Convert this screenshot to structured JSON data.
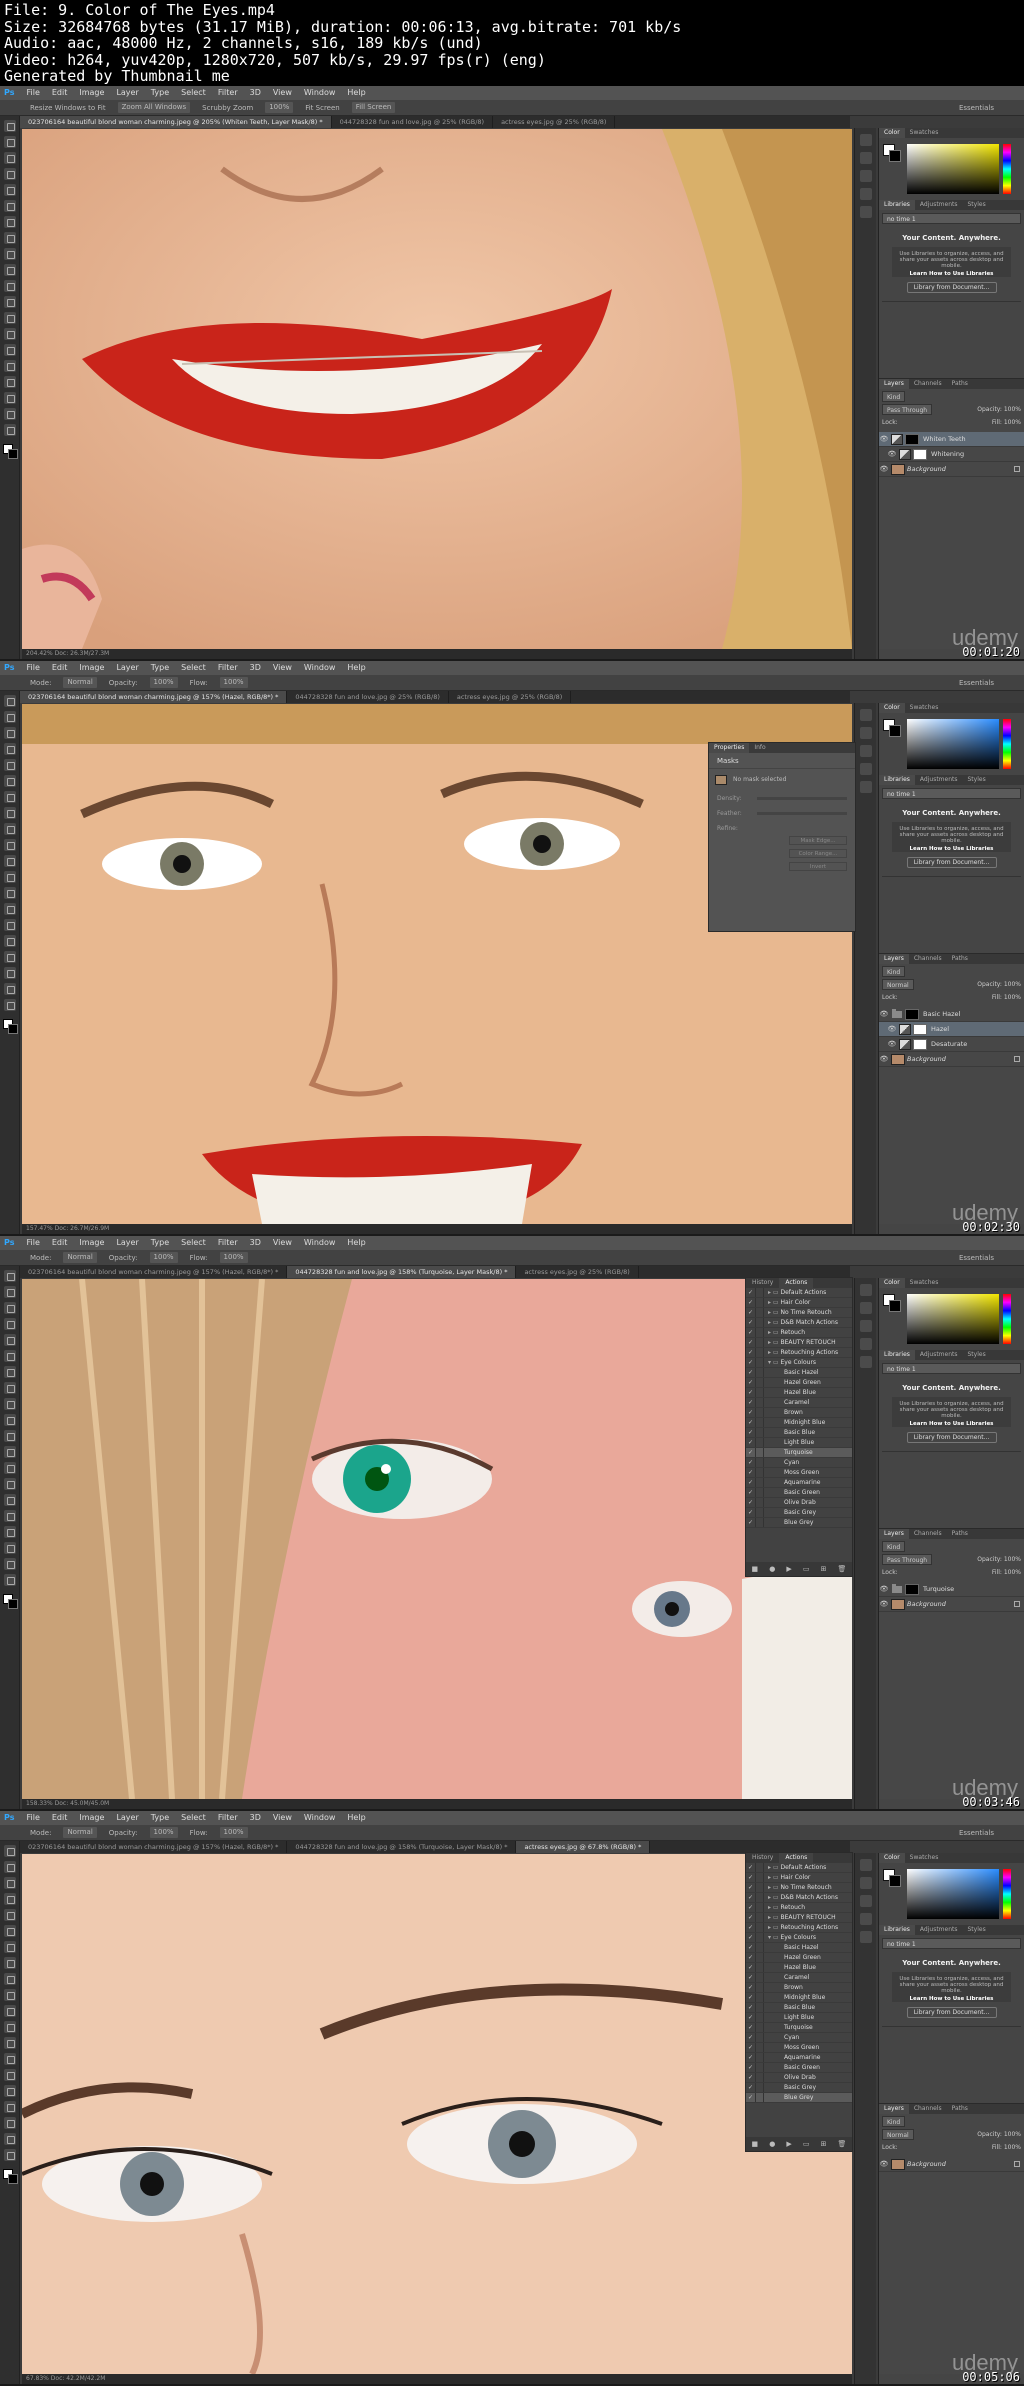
{
  "header": {
    "lines": [
      "File: 9. Color of The Eyes.mp4",
      "Size: 32684768 bytes (31.17 MiB), duration: 00:06:13, avg.bitrate: 701 kb/s",
      "Audio: aac, 48000 Hz, 2 channels, s16, 189 kb/s (und)",
      "Video: h264, yuv420p, 1280x720, 507 kb/s, 29.97 fps(r) (eng)",
      "Generated by Thumbnail me"
    ]
  },
  "menu": [
    "File",
    "Edit",
    "Image",
    "Layer",
    "Type",
    "Select",
    "Filter",
    "3D",
    "View",
    "Window",
    "Help"
  ],
  "workspace": "Essentials",
  "watermark": "udemy",
  "panels": {
    "color_tabs": [
      "Color",
      "Swatches"
    ],
    "lib_tabs": [
      "Libraries",
      "Adjustments",
      "Styles"
    ],
    "library_select": "no time 1",
    "lib_title": "Your Content. Anywhere.",
    "lib_body": "Use Libraries to organize, access, and share your assets across desktop and mobile.",
    "lib_link": "Learn How to Use Libraries",
    "lib_button": "Library from Document...",
    "layer_tabs": [
      "Layers",
      "Channels",
      "Paths"
    ],
    "kind": "Kind",
    "pass_through": "Pass Through",
    "normal": "Normal",
    "opacity": "Opacity: 100%",
    "fill": "Fill: 100%",
    "lock": "Lock:"
  },
  "frames": [
    {
      "optbar": [
        "Resize Windows to Fit",
        "Zoom All Windows",
        "Scrubby Zoom",
        "100%",
        "Fit Screen",
        "Fill Screen"
      ],
      "tabs": [
        "023706164 beautiful blond woman charming.jpeg @ 205% (Whiten Teeth, Layer Mask/8) *",
        "044728328 fun and love.jpg @ 25% (RGB/8)",
        "actress eyes.jpg @ 25% (RGB/8)"
      ],
      "status": "204.42%   Doc: 26.3M/27.3M",
      "layers": [
        {
          "name": "Whiten Teeth",
          "type": "adjust",
          "mask": "black",
          "sel": true,
          "indent": false
        },
        {
          "name": "Whitening",
          "type": "adjust",
          "mask": "white",
          "sel": false,
          "indent": true
        },
        {
          "name": "Background",
          "type": "image",
          "mask": "",
          "sel": false,
          "italic": true
        }
      ],
      "blend": "Pass Through",
      "time": "00:01:20"
    },
    {
      "optbar": [
        "Mode:",
        "Normal",
        "Opacity:",
        "100%",
        "Flow:",
        "100%"
      ],
      "tabs": [
        "023706164 beautiful blond woman charming.jpeg @ 157% (Hazel, RGB/8*) *",
        "044728328 fun and love.jpg @ 25% (RGB/8)",
        "actress eyes.jpg @ 25% (RGB/8)"
      ],
      "status": "157.47%   Doc: 26.7M/26.9M",
      "layers": [
        {
          "name": "Basic Hazel",
          "type": "folder",
          "mask": "black",
          "sel": false
        },
        {
          "name": "Hazel",
          "type": "adjust",
          "mask": "white",
          "sel": true,
          "indent": true
        },
        {
          "name": "Desaturate",
          "type": "adjust",
          "mask": "white",
          "sel": false,
          "indent": true
        },
        {
          "name": "Background",
          "type": "image",
          "mask": "",
          "sel": false,
          "italic": true
        }
      ],
      "blend": "Normal",
      "properties": {
        "tabs": [
          "Properties",
          "Info"
        ],
        "title": "Masks",
        "selection": "No mask selected",
        "rows": [
          "Density:",
          "Feather:",
          "Refine:"
        ],
        "buttons": [
          "Mask Edge...",
          "Color Range...",
          "Invert"
        ]
      },
      "time": "00:02:30"
    },
    {
      "optbar": [
        "Mode:",
        "Normal",
        "Opacity:",
        "100%",
        "Flow:",
        "100%"
      ],
      "tabs": [
        "023706164 beautiful blond woman charming.jpeg @ 157% (Hazel, RGB/8*) *",
        "044728328 fun and love.jpg @ 158% (Turquoise, Layer Mask/8) *",
        "actress eyes.jpg @ 25% (RGB/8)"
      ],
      "status": "158.33%   Doc: 45.0M/45.0M",
      "layers": [
        {
          "name": "Turquoise",
          "type": "folder",
          "mask": "black",
          "sel": false
        },
        {
          "name": "Background",
          "type": "image",
          "mask": "",
          "sel": false,
          "italic": true
        }
      ],
      "blend": "Pass Through",
      "time": "00:03:46"
    },
    {
      "optbar": [
        "Mode:",
        "Normal",
        "Opacity:",
        "100%",
        "Flow:",
        "100%"
      ],
      "tabs": [
        "023706164 beautiful blond woman charming.jpeg @ 157% (Hazel, RGB/8*) *",
        "044728328 fun and love.jpg @ 158% (Turquoise, Layer Mask/8) *",
        "actress eyes.jpg @ 67.8% (RGB/8) *"
      ],
      "status": "67.83%   Doc: 42.2M/42.2M",
      "layers": [
        {
          "name": "Background",
          "type": "image",
          "mask": "",
          "sel": false,
          "italic": true
        }
      ],
      "blend": "Normal",
      "time": "00:05:06"
    }
  ],
  "actions": {
    "tabs": [
      "History",
      "Actions"
    ],
    "rows": [
      {
        "label": "Default Actions",
        "kind": "folder"
      },
      {
        "label": "Hair Color",
        "kind": "folder"
      },
      {
        "label": "No Time Retouch",
        "kind": "folder"
      },
      {
        "label": "D&B Match Actions",
        "kind": "folder"
      },
      {
        "label": "Retouch",
        "kind": "folder"
      },
      {
        "label": "BEAUTY RETOUCH",
        "kind": "folder"
      },
      {
        "label": "Retouching Actions",
        "kind": "folder"
      },
      {
        "label": "Eye Colours",
        "kind": "open"
      },
      {
        "label": "Basic Hazel",
        "kind": "item"
      },
      {
        "label": "Hazel Green",
        "kind": "item"
      },
      {
        "label": "Hazel Blue",
        "kind": "item"
      },
      {
        "label": "Caramel",
        "kind": "item"
      },
      {
        "label": "Brown",
        "kind": "item"
      },
      {
        "label": "Midnight Blue",
        "kind": "item"
      },
      {
        "label": "Basic Blue",
        "kind": "item"
      },
      {
        "label": "Light Blue",
        "kind": "item"
      },
      {
        "label": "Turquoise",
        "kind": "item"
      },
      {
        "label": "Cyan",
        "kind": "item"
      },
      {
        "label": "Moss Green",
        "kind": "item"
      },
      {
        "label": "Aquamarine",
        "kind": "item"
      },
      {
        "label": "Basic Green",
        "kind": "item"
      },
      {
        "label": "Olive Drab",
        "kind": "item"
      },
      {
        "label": "Basic Grey",
        "kind": "item"
      },
      {
        "label": "Blue Grey",
        "kind": "item"
      }
    ],
    "highlight_a3": "Turquoise",
    "highlight_a4": "Blue Grey"
  }
}
